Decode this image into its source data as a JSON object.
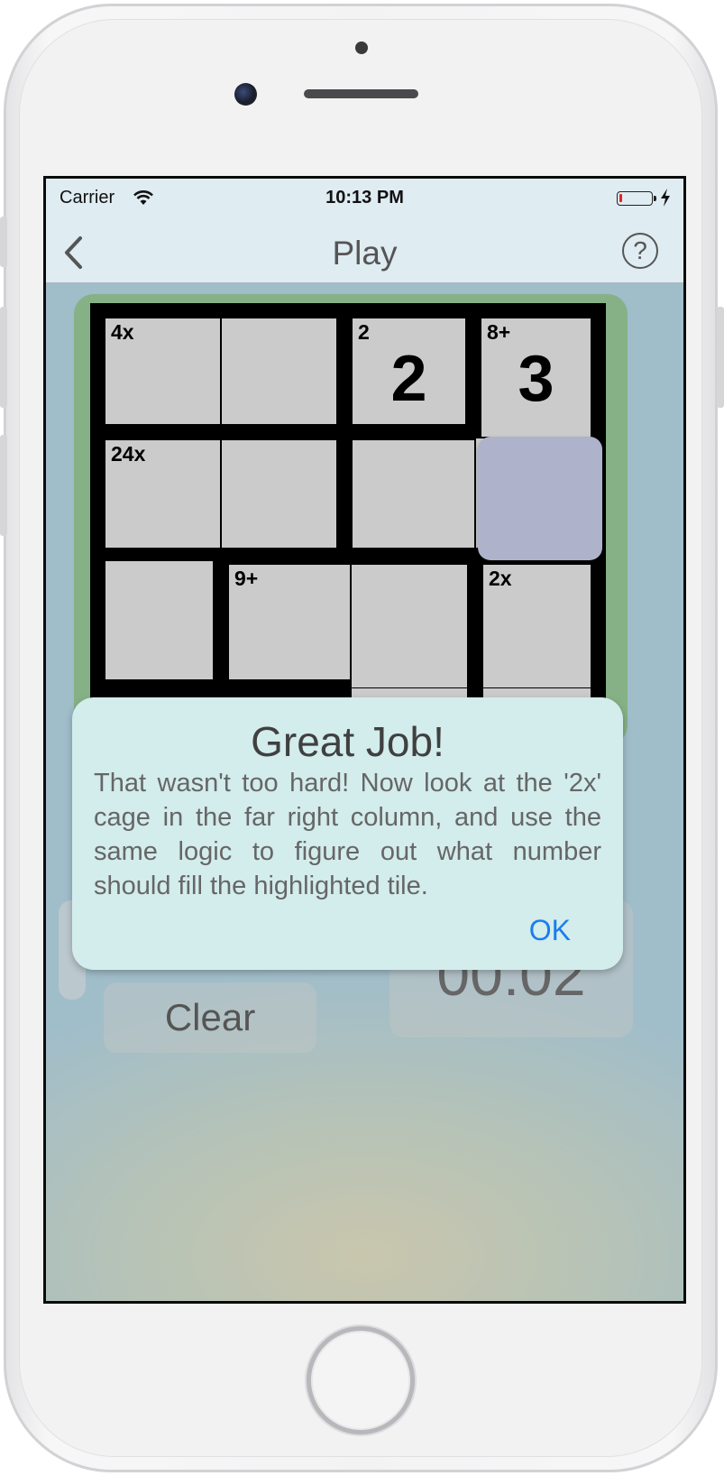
{
  "status_bar": {
    "carrier": "Carrier",
    "time": "10:13 PM"
  },
  "nav": {
    "title": "Play",
    "back_icon": "chevron-left-icon",
    "help_icon": "question-mark-icon",
    "help_glyph": "?"
  },
  "board": {
    "size": 4,
    "cells": [
      {
        "id": "r1c1",
        "label": "4x",
        "value": ""
      },
      {
        "id": "r1c2",
        "label": "",
        "value": ""
      },
      {
        "id": "r1c3",
        "label": "2",
        "value": "2"
      },
      {
        "id": "r1c4",
        "label": "8+",
        "value": "3"
      },
      {
        "id": "r2c1",
        "label": "24x",
        "value": ""
      },
      {
        "id": "r2c2",
        "label": "",
        "value": ""
      },
      {
        "id": "r2c3",
        "label": "",
        "value": ""
      },
      {
        "id": "r2c4",
        "label": "",
        "value": "",
        "selected": true
      },
      {
        "id": "r3c1",
        "label": "",
        "value": ""
      },
      {
        "id": "r3c2",
        "label": "9+",
        "value": ""
      },
      {
        "id": "r3c3",
        "label": "",
        "value": ""
      },
      {
        "id": "r3c4",
        "label": "2x",
        "value": ""
      }
    ]
  },
  "controls": {
    "clear_label": "Clear",
    "timer": "00:02"
  },
  "alert": {
    "title": "Great Job!",
    "message": "That wasn't too hard!  Now look at the '2x' cage in the far right column, and use the same logic to figure out what number should fill the highlighted tile.",
    "ok_label": "OK"
  },
  "colors": {
    "accent": "#1a7df0",
    "board_bg": "#86b186",
    "tile": "#cbcbcb",
    "selected_tile": "#aeb2cb",
    "battery_low": "#e0252a"
  }
}
